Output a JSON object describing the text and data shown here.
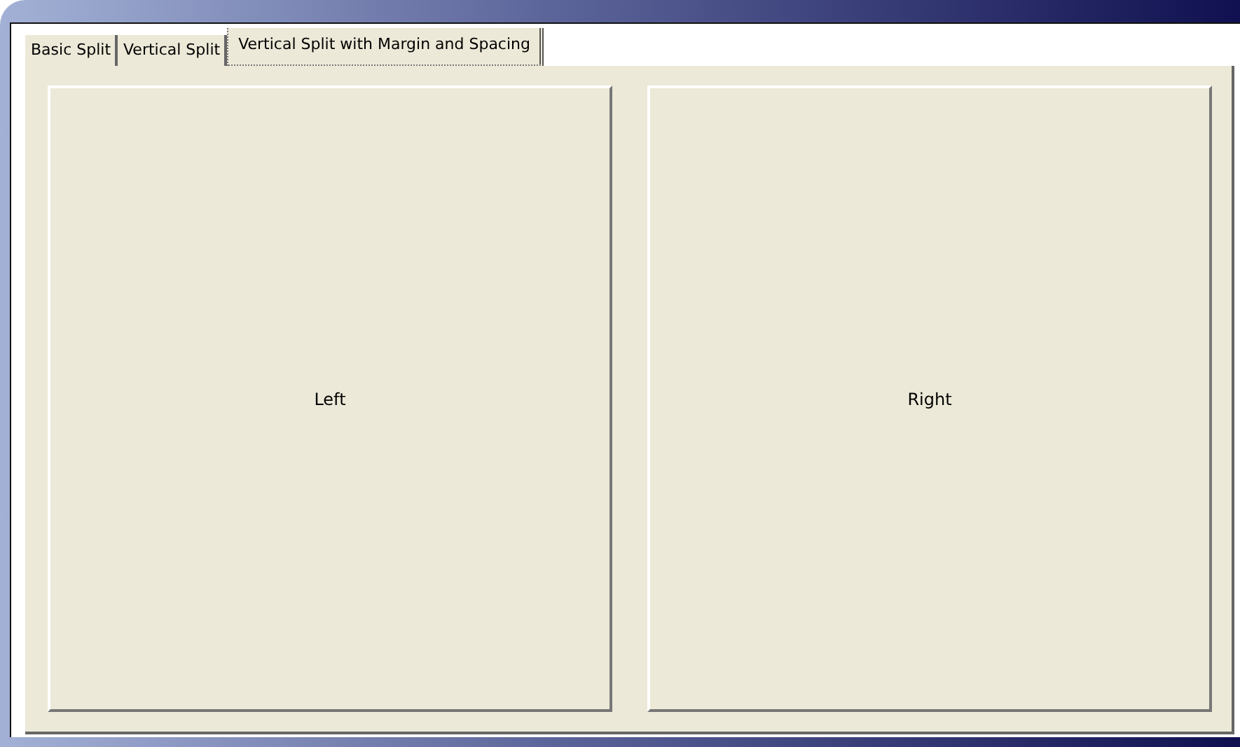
{
  "tabs": [
    {
      "label": "Basic Split",
      "selected": false
    },
    {
      "label": "Vertical Split",
      "selected": false
    },
    {
      "label": "Vertical Split with Margin and Spacing",
      "selected": true
    }
  ],
  "panes": [
    {
      "label": "Left"
    },
    {
      "label": "Right"
    }
  ]
}
